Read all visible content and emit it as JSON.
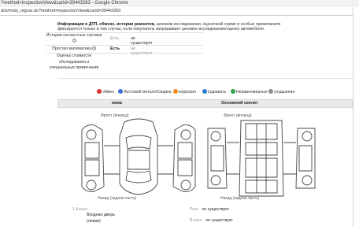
{
  "window": {
    "title": "?method=inspectionView&carid=39443283 - Google Chrome",
    "url": "d/is/mdsl_regcar.do?method=inspectionView&carid=39443283"
  },
  "info": {
    "bold_part": "Информация о ДТП, обмене, истории ремонтов,",
    "rest_part": " ценовом исследовании, оценочной сумме и особых примечаниях фиксируется только в том случае, если покупатель запрашивает ценовое исследование/оценку автомобиля."
  },
  "rows": [
    {
      "label": "История несчастных случаев",
      "has_q": true,
      "status": "Есть",
      "value": "не существует"
    },
    {
      "label": "Простая математика",
      "has_q": true,
      "status": "Есть",
      "value": "не существует"
    },
    {
      "label": "Оценка стоимости обследования и специальные примечания",
      "has_q": false,
      "status": "",
      "value": ""
    }
  ],
  "legend": [
    {
      "label": "обмен",
      "color": "#e03030",
      "glyph": "X"
    },
    {
      "label": "Листовой металл/Сварка",
      "color": "#3b6fd8",
      "glyph": "W"
    },
    {
      "label": "коррозия",
      "color": "#f08a1c",
      "glyph": "C"
    },
    {
      "label": "Царапать",
      "color": "#2b7fd0",
      "glyph": "A"
    },
    {
      "label": "Неравномерные",
      "color": "#2da84a",
      "glyph": "U"
    },
    {
      "label": "ухудшение",
      "color": "#8c8c8c",
      "glyph": "T"
    }
  ],
  "tabs": {
    "left": "кожа",
    "right": "Основной скелет"
  },
  "diagram": {
    "front": "Фронт (вперед)",
    "rear": "Назад (задняя часть)"
  },
  "details_left": {
    "key": "1-й ранг",
    "value_line1": "Входная дверь",
    "value_line2": "(левая)"
  },
  "details_right": [
    {
      "key": "Ранг",
      "value": "не существует"
    },
    {
      "key": "В-ранг",
      "value": "не существует"
    }
  ]
}
